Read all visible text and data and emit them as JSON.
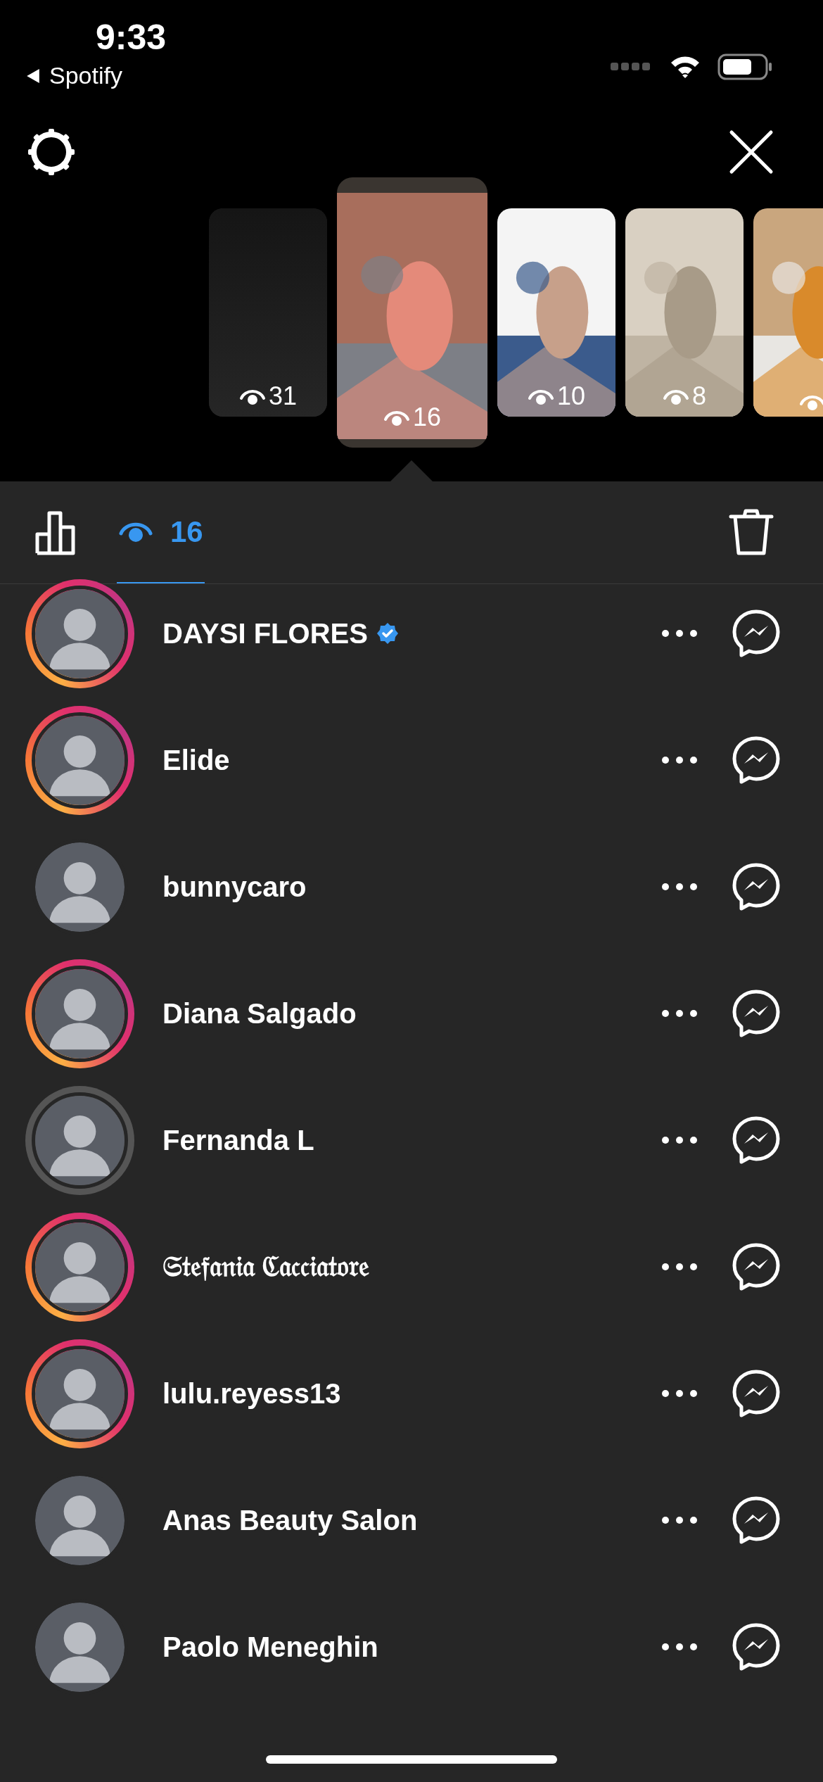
{
  "status_bar": {
    "time": "9:33",
    "back_app": "Spotify"
  },
  "stories": [
    {
      "kind": "dark",
      "views": "31",
      "selected": false
    },
    {
      "kind": "picture",
      "views": "16",
      "selected": true
    },
    {
      "kind": "picture",
      "views": "10",
      "selected": false
    },
    {
      "kind": "picture",
      "views": "8",
      "selected": false
    },
    {
      "kind": "picture",
      "selected": false
    }
  ],
  "viewer_tab": {
    "count": "16",
    "selected": true
  },
  "viewers": [
    {
      "name": "DAYSI FLORES",
      "verified": true,
      "kind": "unseen"
    },
    {
      "name": "Elide",
      "verified": false,
      "kind": "unseen"
    },
    {
      "name": "bunnycaro",
      "verified": false,
      "kind": "plain"
    },
    {
      "name": "Diana Salgado",
      "verified": false,
      "kind": "unseen"
    },
    {
      "name": "Fernanda L",
      "verified": false,
      "kind": "seen"
    },
    {
      "name": "𝔖𝔱𝔢𝔣𝔞𝔫𝔦𝔞 ℭ𝔞𝔠𝔠𝔦𝔞𝔱𝔬𝔯𝔢",
      "verified": false,
      "kind": "unseen"
    },
    {
      "name": "lulu.reyess13",
      "verified": false,
      "kind": "unseen"
    },
    {
      "name": "Anas Beauty Salon",
      "verified": false,
      "kind": "plain"
    },
    {
      "name": "Paolo Meneghin",
      "verified": false,
      "kind": "plain"
    }
  ]
}
